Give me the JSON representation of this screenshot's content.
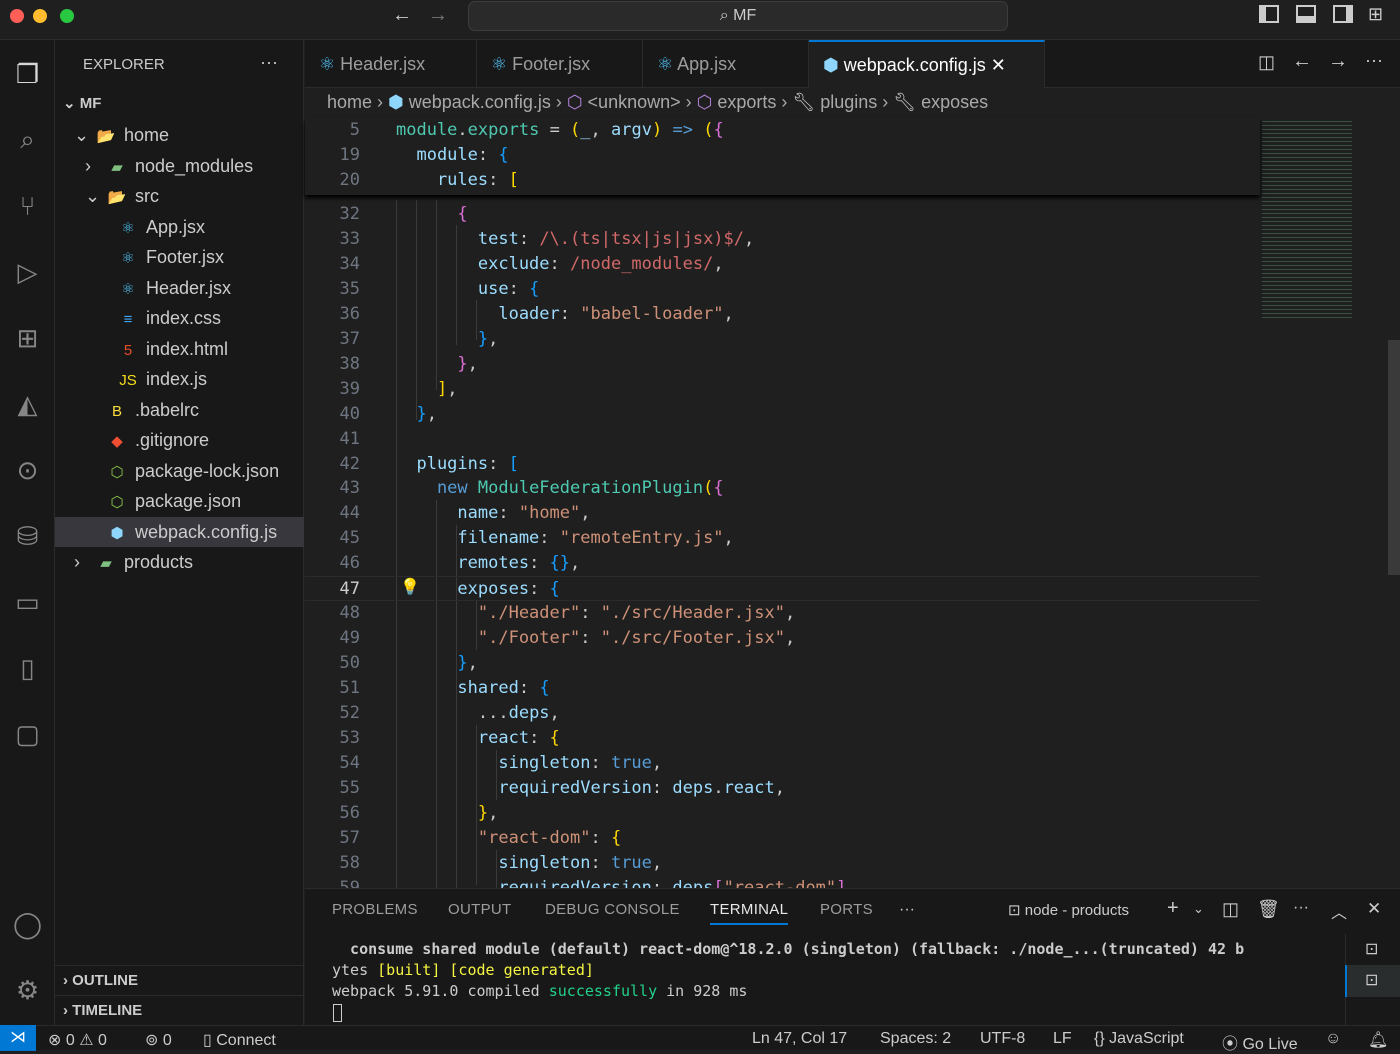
{
  "titlebar": {
    "search": "MF"
  },
  "explorer": {
    "title": "EXPLORER",
    "root": "MF",
    "items": [
      {
        "label": "home",
        "icon": "folder-open-icon",
        "depth": 1
      },
      {
        "label": "node_modules",
        "icon": "folder-icon",
        "depth": 2
      },
      {
        "label": "src",
        "icon": "folder-open-icon",
        "depth": 2
      },
      {
        "label": "App.jsx",
        "icon": "react-icon",
        "depth": 3
      },
      {
        "label": "Footer.jsx",
        "icon": "react-icon",
        "depth": 3
      },
      {
        "label": "Header.jsx",
        "icon": "react-icon",
        "depth": 3
      },
      {
        "label": "index.css",
        "icon": "css-icon",
        "depth": 3
      },
      {
        "label": "index.html",
        "icon": "html-icon",
        "depth": 3
      },
      {
        "label": "index.js",
        "icon": "js-icon",
        "depth": 3
      },
      {
        "label": ".babelrc",
        "icon": "babel-icon",
        "depth": 2
      },
      {
        "label": ".gitignore",
        "icon": "git-icon",
        "depth": 2
      },
      {
        "label": "package-lock.json",
        "icon": "nodejs-icon",
        "depth": 2
      },
      {
        "label": "package.json",
        "icon": "nodejs-icon",
        "depth": 2
      },
      {
        "label": "webpack.config.js",
        "icon": "webpack-icon",
        "depth": 2,
        "selected": true
      },
      {
        "label": "products",
        "icon": "folder-icon",
        "depth": 1
      }
    ],
    "outline": "OUTLINE",
    "timeline": "TIMELINE"
  },
  "tabs": [
    {
      "label": "Header.jsx"
    },
    {
      "label": "Footer.jsx"
    },
    {
      "label": "App.jsx"
    },
    {
      "label": "webpack.config.js",
      "active": true
    }
  ],
  "breadcrumb": [
    "home",
    "webpack.config.js",
    "<unknown>",
    "exports",
    "plugins",
    "exposes"
  ],
  "sticky": [
    {
      "n": "5",
      "t": [
        [
          "module",
          "c"
        ],
        [
          ".",
          "t"
        ],
        [
          "exports",
          "c"
        ],
        [
          " = ",
          "t"
        ],
        [
          "(",
          "y"
        ],
        [
          "_",
          "v"
        ],
        [
          ", ",
          "t"
        ],
        [
          "argv",
          "v"
        ],
        [
          ")",
          "y"
        ],
        [
          " => ",
          "kw"
        ],
        [
          "(",
          "y"
        ],
        [
          "{",
          "p"
        ]
      ]
    },
    {
      "n": "19",
      "t": [
        [
          "  module",
          "k"
        ],
        [
          ": ",
          "t"
        ],
        [
          "{",
          "b"
        ]
      ]
    },
    {
      "n": "20",
      "t": [
        [
          "    rules",
          "k"
        ],
        [
          ": ",
          "t"
        ],
        [
          "[",
          "y"
        ]
      ]
    }
  ],
  "code": [
    {
      "n": "32",
      "t": [
        [
          "      {",
          "p"
        ]
      ]
    },
    {
      "n": "33",
      "t": [
        [
          "        test",
          "k"
        ],
        [
          ": ",
          "t"
        ],
        [
          "/\\.(ts|tsx|js|jsx)$/",
          "r"
        ],
        [
          ",",
          "t"
        ]
      ]
    },
    {
      "n": "34",
      "t": [
        [
          "        exclude",
          "k"
        ],
        [
          ": ",
          "t"
        ],
        [
          "/node_modules/",
          "r"
        ],
        [
          ",",
          "t"
        ]
      ]
    },
    {
      "n": "35",
      "t": [
        [
          "        use",
          "k"
        ],
        [
          ": ",
          "t"
        ],
        [
          "{",
          "b"
        ]
      ]
    },
    {
      "n": "36",
      "t": [
        [
          "          loader",
          "k"
        ],
        [
          ": ",
          "t"
        ],
        [
          "\"babel-loader\"",
          "s"
        ],
        [
          ",",
          "t"
        ]
      ]
    },
    {
      "n": "37",
      "t": [
        [
          "        }",
          "b"
        ],
        [
          ",",
          "t"
        ]
      ]
    },
    {
      "n": "38",
      "t": [
        [
          "      }",
          "p"
        ],
        [
          ",",
          "t"
        ]
      ]
    },
    {
      "n": "39",
      "t": [
        [
          "    ]",
          "y"
        ],
        [
          ",",
          "t"
        ]
      ]
    },
    {
      "n": "40",
      "t": [
        [
          "  }",
          "b"
        ],
        [
          ",",
          "t"
        ]
      ]
    },
    {
      "n": "41",
      "t": []
    },
    {
      "n": "42",
      "t": [
        [
          "  plugins",
          "k"
        ],
        [
          ": ",
          "t"
        ],
        [
          "[",
          "b"
        ]
      ]
    },
    {
      "n": "43",
      "t": [
        [
          "    new ",
          "kw"
        ],
        [
          "ModuleFederationPlugin",
          "c"
        ],
        [
          "(",
          "y"
        ],
        [
          "{",
          "p"
        ]
      ]
    },
    {
      "n": "44",
      "t": [
        [
          "      name",
          "k"
        ],
        [
          ": ",
          "t"
        ],
        [
          "\"home\"",
          "s"
        ],
        [
          ",",
          "t"
        ]
      ]
    },
    {
      "n": "45",
      "t": [
        [
          "      filename",
          "k"
        ],
        [
          ": ",
          "t"
        ],
        [
          "\"remoteEntry.js\"",
          "s"
        ],
        [
          ",",
          "t"
        ]
      ]
    },
    {
      "n": "46",
      "t": [
        [
          "      remotes",
          "k"
        ],
        [
          ": ",
          "t"
        ],
        [
          "{}",
          "b"
        ],
        [
          ",",
          "t"
        ]
      ]
    },
    {
      "n": "47",
      "t": [
        [
          "      exposes",
          "k"
        ],
        [
          ": ",
          "t"
        ],
        [
          "{",
          "b"
        ]
      ],
      "current": true
    },
    {
      "n": "48",
      "t": [
        [
          "        \"./Header\"",
          "s"
        ],
        [
          ": ",
          "t"
        ],
        [
          "\"./src/Header.jsx\"",
          "s"
        ],
        [
          ",",
          "t"
        ]
      ]
    },
    {
      "n": "49",
      "t": [
        [
          "        \"./Footer\"",
          "s"
        ],
        [
          ": ",
          "t"
        ],
        [
          "\"./src/Footer.jsx\"",
          "s"
        ],
        [
          ",",
          "t"
        ]
      ]
    },
    {
      "n": "50",
      "t": [
        [
          "      }",
          "b"
        ],
        [
          ",",
          "t"
        ]
      ]
    },
    {
      "n": "51",
      "t": [
        [
          "      shared",
          "k"
        ],
        [
          ": ",
          "t"
        ],
        [
          "{",
          "b"
        ]
      ]
    },
    {
      "n": "52",
      "t": [
        [
          "        ...",
          "t"
        ],
        [
          "deps",
          "v"
        ],
        [
          ",",
          "t"
        ]
      ]
    },
    {
      "n": "53",
      "t": [
        [
          "        react",
          "k"
        ],
        [
          ": ",
          "t"
        ],
        [
          "{",
          "y"
        ]
      ]
    },
    {
      "n": "54",
      "t": [
        [
          "          singleton",
          "k"
        ],
        [
          ": ",
          "t"
        ],
        [
          "true",
          "kw"
        ],
        [
          ",",
          "t"
        ]
      ]
    },
    {
      "n": "55",
      "t": [
        [
          "          requiredVersion",
          "k"
        ],
        [
          ": ",
          "t"
        ],
        [
          "deps",
          "v"
        ],
        [
          ".",
          "t"
        ],
        [
          "react",
          "v"
        ],
        [
          ",",
          "t"
        ]
      ]
    },
    {
      "n": "56",
      "t": [
        [
          "        }",
          "y"
        ],
        [
          ",",
          "t"
        ]
      ]
    },
    {
      "n": "57",
      "t": [
        [
          "        \"react-dom\"",
          "s"
        ],
        [
          ": ",
          "t"
        ],
        [
          "{",
          "y"
        ]
      ]
    },
    {
      "n": "58",
      "t": [
        [
          "          singleton",
          "k"
        ],
        [
          ": ",
          "t"
        ],
        [
          "true",
          "kw"
        ],
        [
          ",",
          "t"
        ]
      ]
    },
    {
      "n": "59",
      "t": [
        [
          "          requiredVersion",
          "k"
        ],
        [
          ": ",
          "t"
        ],
        [
          "deps",
          "v"
        ],
        [
          "[",
          "p"
        ],
        [
          "\"react-dom\"",
          "s"
        ],
        [
          "]",
          "p"
        ]
      ]
    }
  ],
  "panel": {
    "tabs": [
      "PROBLEMS",
      "OUTPUT",
      "DEBUG CONSOLE",
      "TERMINAL",
      "PORTS"
    ],
    "active": "TERMINAL",
    "terminal_name": "node - products",
    "lines": [
      [
        [
          "  consume shared module (default) react-dom@^18.2.0 (singleton) (fallback: ./node_...(truncated) 42 b",
          "t"
        ]
      ],
      [
        [
          "ytes ",
          "t"
        ],
        [
          "[built] [code generated]",
          "y"
        ]
      ],
      [
        [
          "webpack 5.91.0 compiled ",
          "t"
        ],
        [
          "successfully",
          "c"
        ],
        [
          " in 928 ms",
          "t"
        ]
      ]
    ]
  },
  "status": {
    "errors": "0",
    "warnings": "0",
    "ports": "0",
    "connect": "Connect",
    "position": "Ln 47, Col 17",
    "spaces": "Spaces: 2",
    "encoding": "UTF-8",
    "eol": "LF",
    "language": "JavaScript",
    "golive": "Go Live"
  },
  "colors": {
    "accent": "#0078d4",
    "background": "#1f1f1f",
    "sidebar": "#181818"
  }
}
